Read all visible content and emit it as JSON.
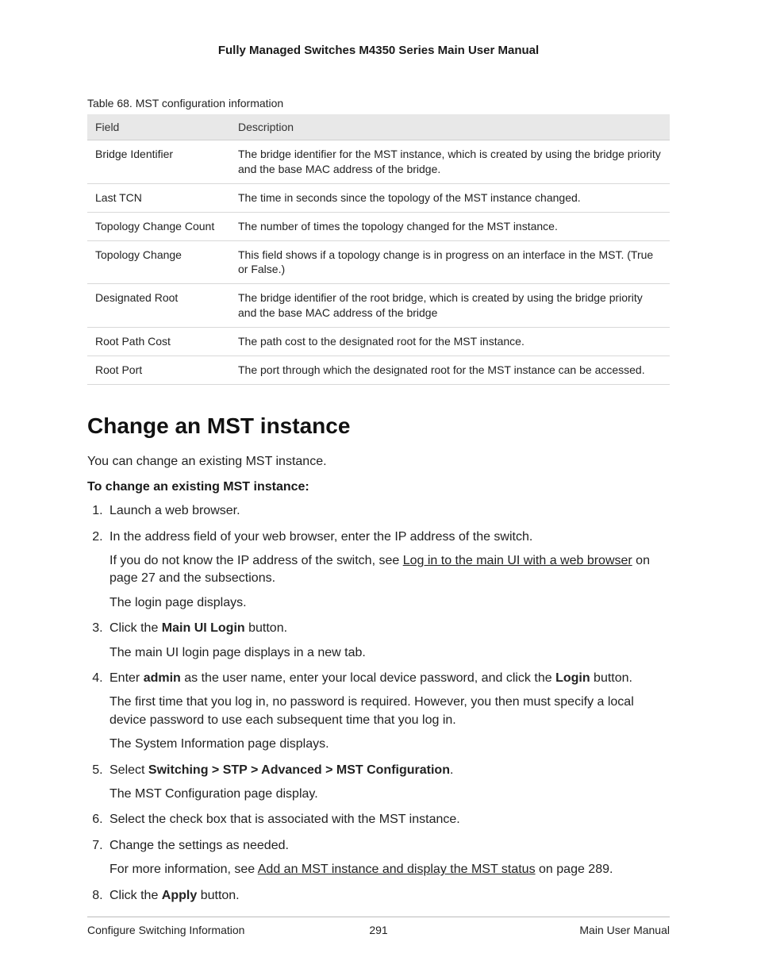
{
  "header": {
    "doc_title": "Fully Managed Switches M4350 Series Main User Manual"
  },
  "table": {
    "caption": "Table 68. MST configuration information",
    "headers": {
      "field": "Field",
      "description": "Description"
    },
    "rows": [
      {
        "field": "Bridge Identifier",
        "desc": "The bridge identifier for the MST instance, which is created by using the bridge priority and the base MAC address of the bridge."
      },
      {
        "field": "Last TCN",
        "desc": "The time in seconds since the topology of the MST instance changed."
      },
      {
        "field": "Topology Change Count",
        "desc": "The number of times the topology changed for the MST instance."
      },
      {
        "field": "Topology Change",
        "desc": "This field shows if a topology change is in progress on an interface in the MST. (True or False.)"
      },
      {
        "field": "Designated Root",
        "desc": "The bridge identifier of the root bridge, which is created by using the bridge priority and the base MAC address of the bridge"
      },
      {
        "field": "Root Path Cost",
        "desc": "The path cost to the designated root for the MST instance."
      },
      {
        "field": "Root Port",
        "desc": "The port through which the designated root for the MST instance can be accessed."
      }
    ]
  },
  "section": {
    "heading": "Change an MST instance",
    "intro": "You can change an existing MST instance.",
    "subhead": "To change an existing MST instance:"
  },
  "steps": {
    "s1": "Launch a web browser.",
    "s2": {
      "line": "In the address field of your web browser, enter the IP address of the switch.",
      "p1a": "If you do not know the IP address of the switch, see ",
      "p1link": "Log in to the main UI with a web browser",
      "p1b": " on page 27 and the subsections.",
      "p2": "The login page displays."
    },
    "s3": {
      "a": "Click the ",
      "b": "Main UI Login",
      "c": " button.",
      "p1": "The main UI login page displays in a new tab."
    },
    "s4": {
      "a": "Enter ",
      "b": "admin",
      "c": " as the user name, enter your local device password, and click the ",
      "d": "Login",
      "e": " button.",
      "p1": "The first time that you log in, no password is required. However, you then must specify a local device password to use each subsequent time that you log in.",
      "p2": "The System Information page displays."
    },
    "s5": {
      "a": "Select ",
      "b": "Switching > STP > Advanced > MST Configuration",
      "c": ".",
      "p1": "The MST Configuration page display."
    },
    "s6": "Select the check box that is associated with the MST instance.",
    "s7": {
      "line": "Change the settings as needed.",
      "p1a": "For more information, see ",
      "p1link": "Add an MST instance and display the MST status",
      "p1b": " on page 289."
    },
    "s8": {
      "a": "Click the ",
      "b": "Apply",
      "c": " button."
    }
  },
  "footer": {
    "left": "Configure Switching Information",
    "center": "291",
    "right": "Main User Manual"
  }
}
